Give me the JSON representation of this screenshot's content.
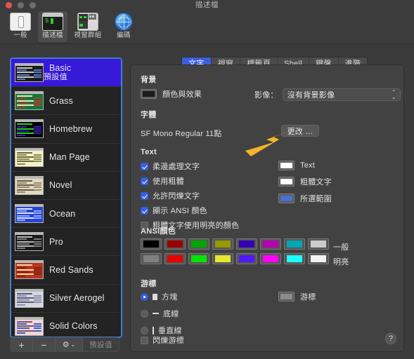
{
  "window": {
    "title": "描述檔",
    "traffic_lights": [
      "close",
      "minimize",
      "zoom"
    ]
  },
  "toolbar": {
    "items": [
      {
        "label": "一般",
        "icon": "general-icon",
        "selected": false
      },
      {
        "label": "描述檔",
        "icon": "profiles-icon",
        "selected": true
      },
      {
        "label": "視窗群組",
        "icon": "window-groups-icon",
        "selected": false
      },
      {
        "label": "編碼",
        "icon": "encodings-icon",
        "selected": false
      }
    ]
  },
  "sidebar": {
    "profiles": [
      {
        "name": "Basic",
        "subtitle": "預設值",
        "selected": true,
        "bg": "#1b1b1b",
        "fg": "#c8c8c8",
        "accent": "#5b79c8"
      },
      {
        "name": "Grass",
        "subtitle": "",
        "selected": false,
        "bg": "#13773d",
        "fg": "#e8e8c0",
        "accent": "#b33a2a"
      },
      {
        "name": "Homebrew",
        "subtitle": "",
        "selected": false,
        "bg": "#000000",
        "fg": "#23d423",
        "accent": "#3c1fb0"
      },
      {
        "name": "Man Page",
        "subtitle": "",
        "selected": false,
        "bg": "#f2f1c8",
        "fg": "#6b6a3c",
        "accent": "#8c8a55"
      },
      {
        "name": "Novel",
        "subtitle": "",
        "selected": false,
        "bg": "#dfdbc3",
        "fg": "#6b5b47",
        "accent": "#9a8a6a"
      },
      {
        "name": "Ocean",
        "subtitle": "",
        "selected": false,
        "bg": "#2244d8",
        "fg": "#dfe6ff",
        "accent": "#8fa8f5"
      },
      {
        "name": "Pro",
        "subtitle": "",
        "selected": false,
        "bg": "#1a1a1a",
        "fg": "#b8b8b8",
        "accent": "#7a7a7a"
      },
      {
        "name": "Red Sands",
        "subtitle": "",
        "selected": false,
        "bg": "#b8361f",
        "fg": "#f0d9a0",
        "accent": "#7e2413"
      },
      {
        "name": "Silver Aerogel",
        "subtitle": "",
        "selected": false,
        "bg": "#d8d8e0",
        "fg": "#5a5a78",
        "accent": "#8e8eb4"
      },
      {
        "name": "Solid Colors",
        "subtitle": "",
        "selected": false,
        "bg": "#f2d7dd",
        "fg": "#7a5560",
        "accent": "#3a5fc0"
      }
    ],
    "bottom": {
      "add_label": "+",
      "remove_label": "−",
      "gear_label": "⚙",
      "gear_arrow": "⌄",
      "default_label": "預設值"
    }
  },
  "tabs": [
    {
      "label": "文字",
      "active": true
    },
    {
      "label": "視窗",
      "active": false
    },
    {
      "label": "標籤頁",
      "active": false
    },
    {
      "label": "Shell",
      "active": false
    },
    {
      "label": "鍵盤",
      "active": false
    },
    {
      "label": "進階",
      "active": false
    }
  ],
  "panel": {
    "background": {
      "section_title": "背景",
      "color_effects_label": "顏色與效果",
      "color_well": "#1b1b1b",
      "image_label": "影像：",
      "image_value": "沒有背景影像",
      "image_arrows": "⌃⌄"
    },
    "font": {
      "section_title": "字體",
      "current": "SF Mono Regular 11點",
      "change_button": "更改 …"
    },
    "text": {
      "section_title": "Text",
      "checkboxes": [
        {
          "label": "柔邊處理文字",
          "checked": true
        },
        {
          "label": "使用粗體",
          "checked": true
        },
        {
          "label": "允許閃爍文字",
          "checked": true
        },
        {
          "label": "顯示 ANSI 顏色",
          "checked": true
        },
        {
          "label": "粗體文字使用明亮的顏色",
          "checked": false
        }
      ],
      "color_wells": [
        {
          "label": "Text",
          "color": "#ffffff"
        },
        {
          "label": "粗體文字",
          "color": "#ffffff"
        },
        {
          "label": "所選範圍",
          "color": "#4a6fd4"
        }
      ]
    },
    "ansi": {
      "section_title": "ANSI顏色",
      "normal_label": "一般",
      "bright_label": "明亮",
      "normal": [
        "#000000",
        "#990000",
        "#00a600",
        "#999900",
        "#3300b3",
        "#b300b3",
        "#00a6b3",
        "#cccccc"
      ],
      "bright": [
        "#808080",
        "#e60000",
        "#00e600",
        "#e6e633",
        "#4d1aff",
        "#ff00ff",
        "#1affff",
        "#f2f2f2"
      ]
    },
    "cursor": {
      "section_title": "游標",
      "options": [
        {
          "label": "方塊",
          "glyph": "block",
          "selected": true
        },
        {
          "label": "底線",
          "glyph": "underline",
          "selected": false
        },
        {
          "label": "垂直線",
          "glyph": "bar",
          "selected": false
        }
      ],
      "blink": {
        "label": "閃爍游標",
        "checked": false
      },
      "color_well": {
        "label": "游標",
        "color": "#8c8c8c"
      }
    },
    "help_button": "?"
  },
  "annotation": {
    "arrow_color": "#f5b32a",
    "points_to": "更改 …"
  }
}
